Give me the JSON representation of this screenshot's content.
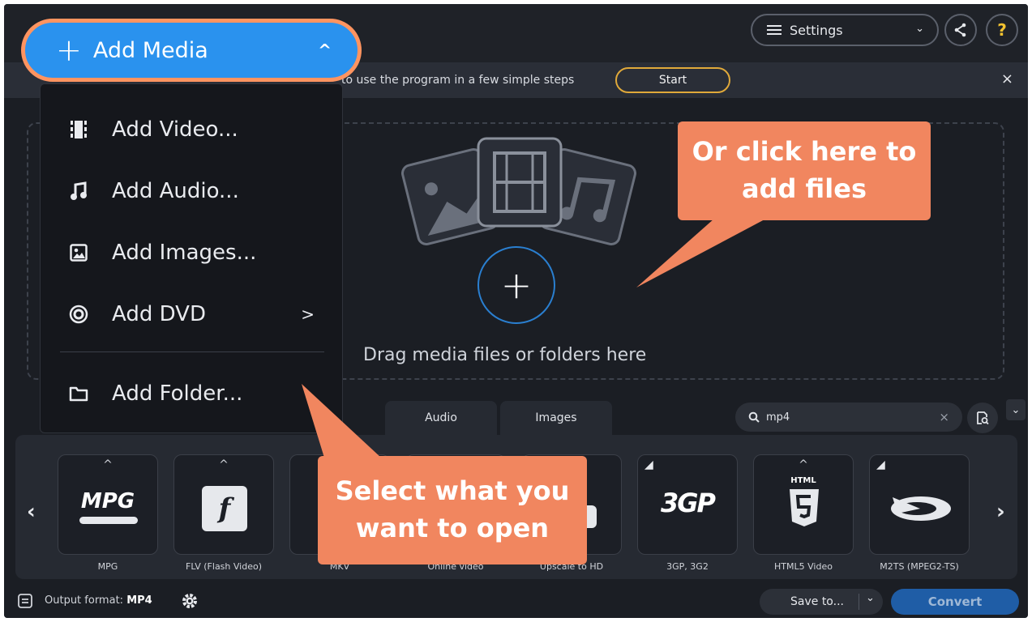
{
  "header": {
    "add_media_label": "Add Media",
    "settings_label": "Settings",
    "help_symbol": "?"
  },
  "tip": {
    "text": "to use the program in a few simple steps",
    "start_label": "Start",
    "close_symbol": "×"
  },
  "add_menu": {
    "items": [
      {
        "label": "Add Video...",
        "icon": "film-icon"
      },
      {
        "label": "Add Audio...",
        "icon": "music-note-icon"
      },
      {
        "label": "Add Images...",
        "icon": "image-icon"
      },
      {
        "label": "Add DVD",
        "icon": "disc-icon",
        "has_submenu": true
      },
      {
        "label": "Add Folder...",
        "icon": "folder-icon"
      }
    ],
    "submenu_arrow": ">"
  },
  "dropzone": {
    "drag_text": "Drag media files or folders here"
  },
  "callouts": {
    "click_here": "Or click here to add files",
    "select_what": "Select what you want to open"
  },
  "tabs": [
    "Audio",
    "Images"
  ],
  "search": {
    "value": "mp4",
    "clear_symbol": "×"
  },
  "formats": [
    {
      "label": "MPG",
      "logo": "MPG"
    },
    {
      "label": "FLV (Flash Video)",
      "logo": "f"
    },
    {
      "label": "MKV",
      "logo": ""
    },
    {
      "label": "Online video",
      "logo": ""
    },
    {
      "label": "Upscale to HD",
      "logo": ""
    },
    {
      "label": "3GP, 3G2",
      "logo": "3GP"
    },
    {
      "label": "HTML5 Video",
      "logo": "HTML"
    },
    {
      "label": "M2TS (MPEG2-TS)",
      "logo": ""
    }
  ],
  "footer": {
    "output_label": "Output format:",
    "output_value": "MP4",
    "save_to_label": "Save to...",
    "convert_label": "Convert"
  },
  "colors": {
    "accent_blue": "#2a92ee",
    "callout_orange": "#f1865f",
    "highlight_border": "#ff9460",
    "app_bg": "#1b1e24"
  }
}
